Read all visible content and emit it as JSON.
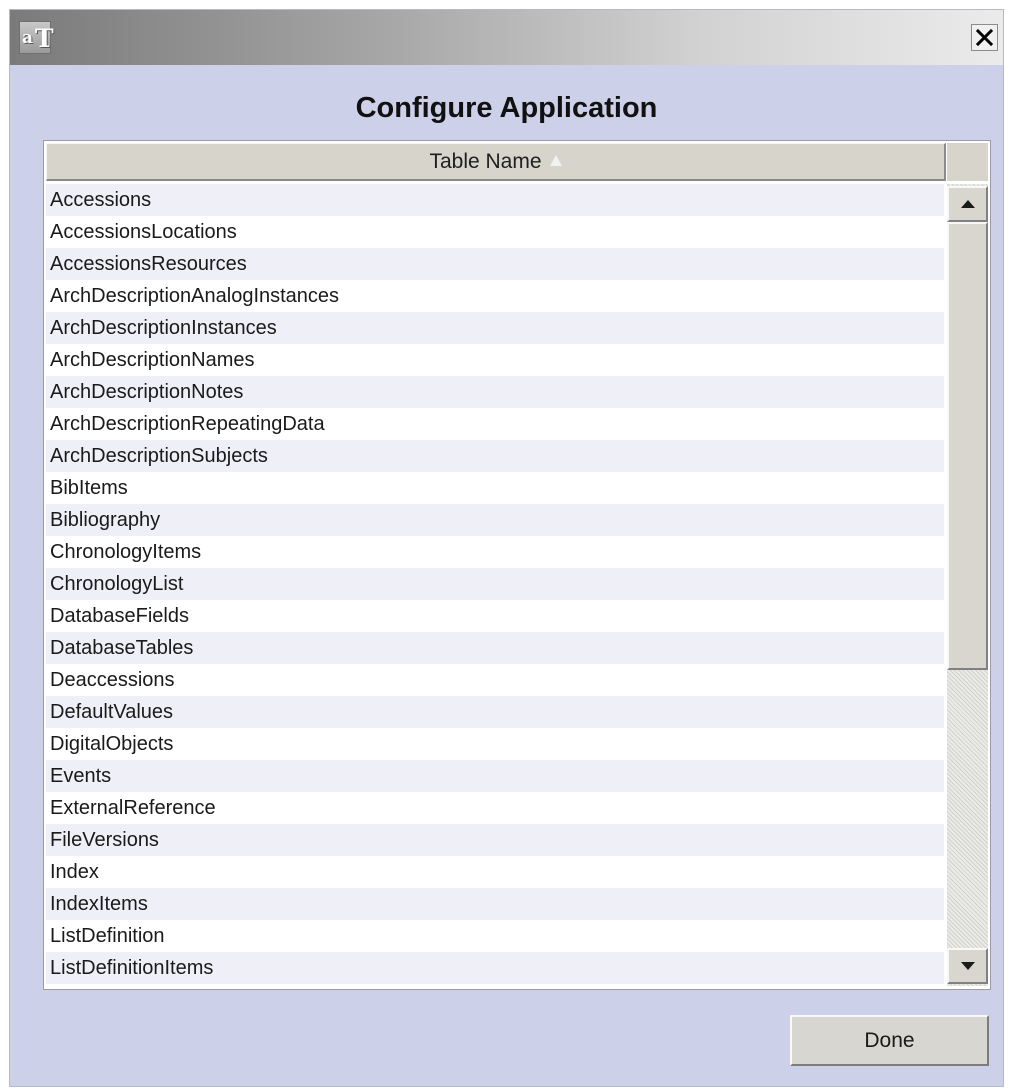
{
  "window": {
    "logo_text": "aT",
    "close_icon": "close-icon"
  },
  "dialog": {
    "title": "Configure Application"
  },
  "table": {
    "column_header": "Table Name",
    "sort_icon": "sort-ascending-icon",
    "rows": [
      "Accessions",
      "AccessionsLocations",
      "AccessionsResources",
      "ArchDescriptionAnalogInstances",
      "ArchDescriptionInstances",
      "ArchDescriptionNames",
      "ArchDescriptionNotes",
      "ArchDescriptionRepeatingData",
      "ArchDescriptionSubjects",
      "BibItems",
      "Bibliography",
      "ChronologyItems",
      "ChronologyList",
      "DatabaseFields",
      "DatabaseTables",
      "Deaccessions",
      "DefaultValues",
      "DigitalObjects",
      "Events",
      "ExternalReference",
      "FileVersions",
      "Index",
      "IndexItems",
      "ListDefinition",
      "ListDefinitionItems"
    ]
  },
  "scrollbar": {
    "up_icon": "arrow-up-icon",
    "down_icon": "arrow-down-icon"
  },
  "footer": {
    "done_label": "Done"
  },
  "colors": {
    "window_background": "#ccd0e8",
    "row_alternate": "#efeff7",
    "header_background": "#d6d4cb"
  }
}
